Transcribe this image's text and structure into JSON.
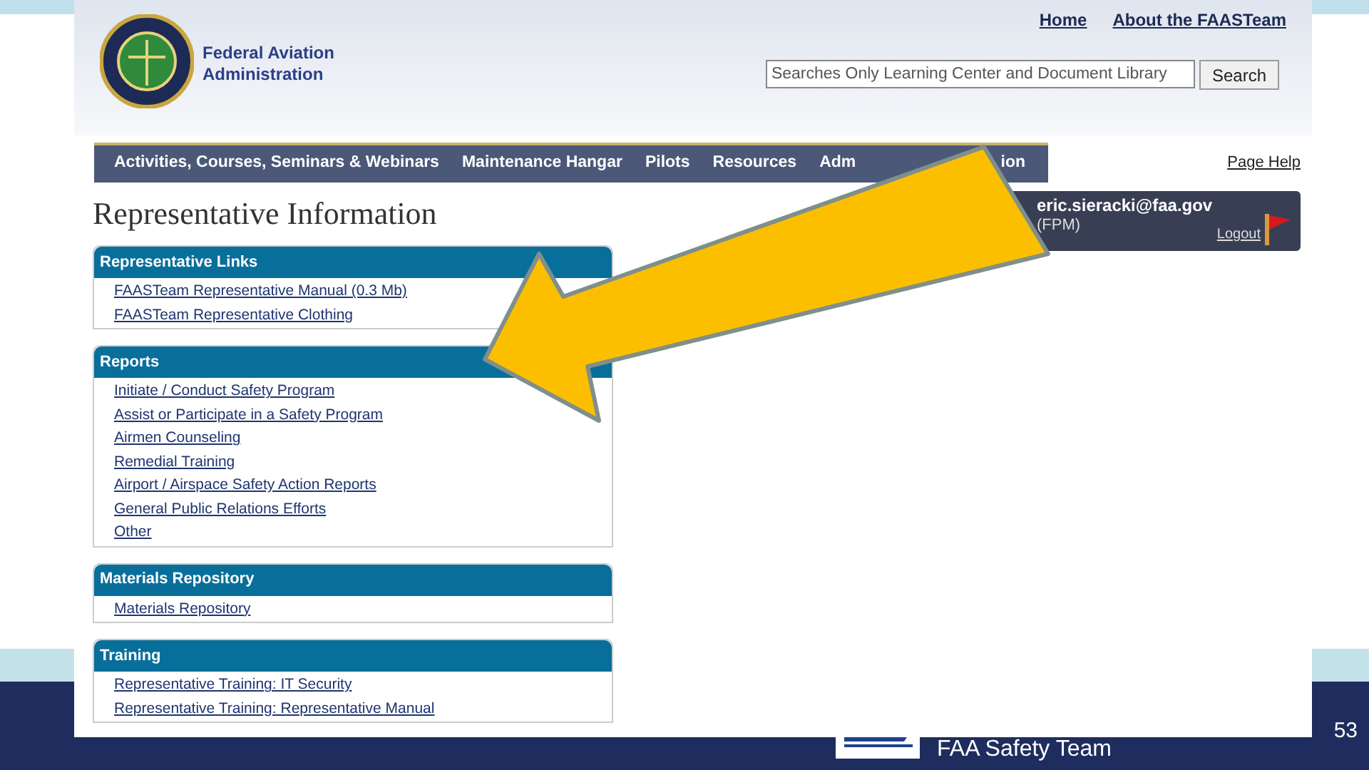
{
  "header": {
    "org_name": "Federal Aviation Administration",
    "top_links": [
      "Home",
      "About the FAASTeam"
    ],
    "search": {
      "placeholder": "Searches Only Learning Center and Document Library",
      "button": "Search"
    }
  },
  "nav": {
    "items": [
      "Activities, Courses, Seminars & Webinars",
      "Maintenance Hangar",
      "Pilots",
      "Resources",
      "Adm",
      "ion"
    ],
    "help": "Page Help"
  },
  "page_title": "Representative Information",
  "user": {
    "email": "eric.sieracki@faa.gov",
    "role": "(FPM)",
    "logout": "Logout"
  },
  "panels": [
    {
      "title": "Representative Links",
      "links": [
        "FAASTeam Representative Manual (0.3 Mb)",
        "FAASTeam Representative Clothing"
      ]
    },
    {
      "title": "Reports",
      "links": [
        "Initiate / Conduct Safety Program",
        "Assist or Participate in a Safety Program",
        "Airmen Counseling",
        "Remedial Training",
        "Airport / Airspace Safety Action Reports",
        "General Public Relations Efforts",
        "Other"
      ]
    },
    {
      "title": "Materials Repository",
      "links": [
        "Materials Repository"
      ]
    },
    {
      "title": "Training",
      "links": [
        "Representative Training: IT Security",
        "Representative Training: Representative Manual"
      ]
    }
  ],
  "footer": {
    "team": "FAA Safety Team",
    "slide_number": "53"
  }
}
